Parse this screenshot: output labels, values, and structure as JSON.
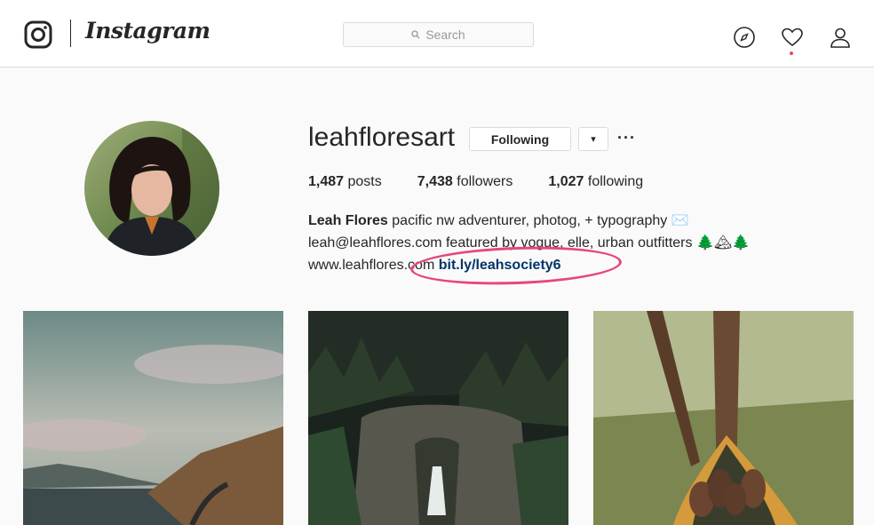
{
  "nav": {
    "brand": "Instagram",
    "search_placeholder": "Search",
    "icons": [
      "instagram-glyph-icon",
      "search-icon",
      "compass-icon",
      "heart-icon",
      "person-icon"
    ],
    "notification_color": "#ed4956"
  },
  "profile": {
    "username": "leahfloresart",
    "follow_button": "Following",
    "dropdown_glyph": "▾",
    "more_glyph": "···",
    "stats": [
      {
        "count": "1,487",
        "label": "posts"
      },
      {
        "count": "7,438",
        "label": "followers"
      },
      {
        "count": "1,027",
        "label": "following"
      }
    ],
    "bio": {
      "name": "Leah Flores",
      "line1": "pacific nw adventurer, photog, + typography ✉️",
      "line2": "leah@leahflores.com featured by vogue, elle, urban outfitters 🌲🏔🌲",
      "website": "www.leahflores.com",
      "link": "bit.ly/leahsociety6"
    },
    "highlight_color": "#e8467a",
    "link_color": "#003569"
  },
  "posts": [
    {
      "name": "post-coastal-road"
    },
    {
      "name": "post-forest-waterfall"
    },
    {
      "name": "post-hammock-boots"
    }
  ]
}
